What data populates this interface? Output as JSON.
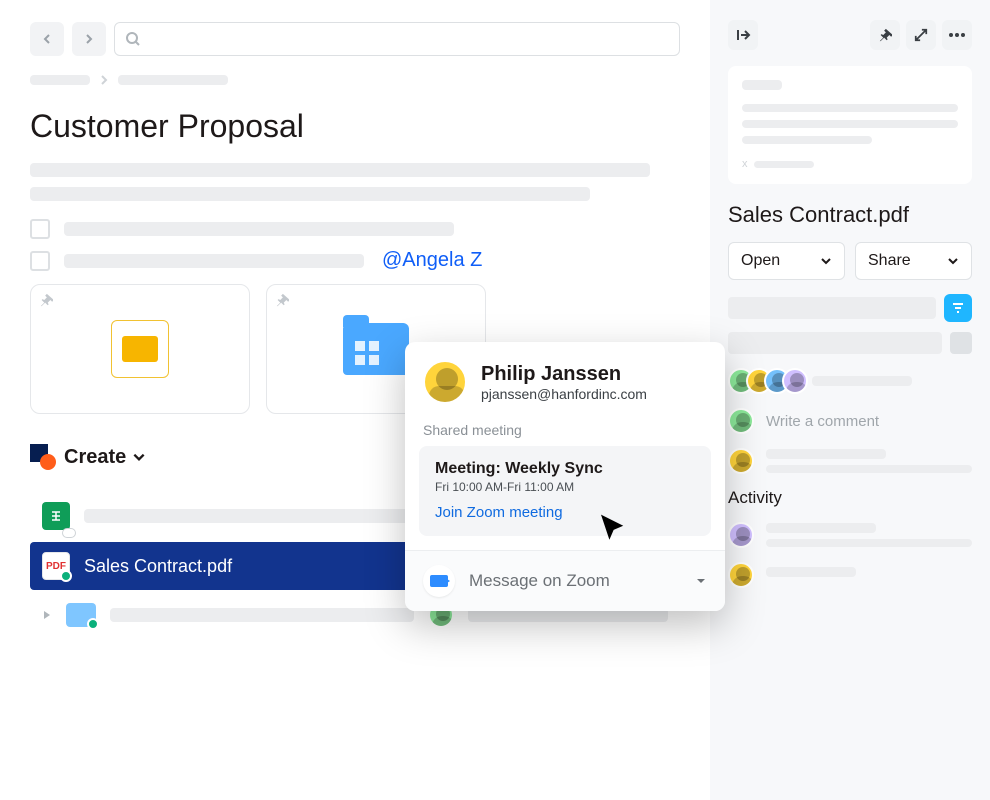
{
  "page": {
    "title": "Customer Proposal",
    "mention": "@Angela Z"
  },
  "create": {
    "label": "Create"
  },
  "files": {
    "selected_name": "Sales Contract.pdf"
  },
  "hover_card": {
    "name": "Philip Janssen",
    "email": "pjanssen@hanfordinc.com",
    "section_label": "Shared meeting",
    "meeting_title": "Meeting: Weekly Sync",
    "meeting_time": "Fri 10:00 AM-Fri 11:00 AM",
    "join_link": "Join Zoom meeting",
    "footer": "Message on Zoom"
  },
  "side": {
    "file_name": "Sales Contract.pdf",
    "open_label": "Open",
    "share_label": "Share",
    "comment_placeholder": "Write a comment",
    "activity_label": "Activity"
  }
}
